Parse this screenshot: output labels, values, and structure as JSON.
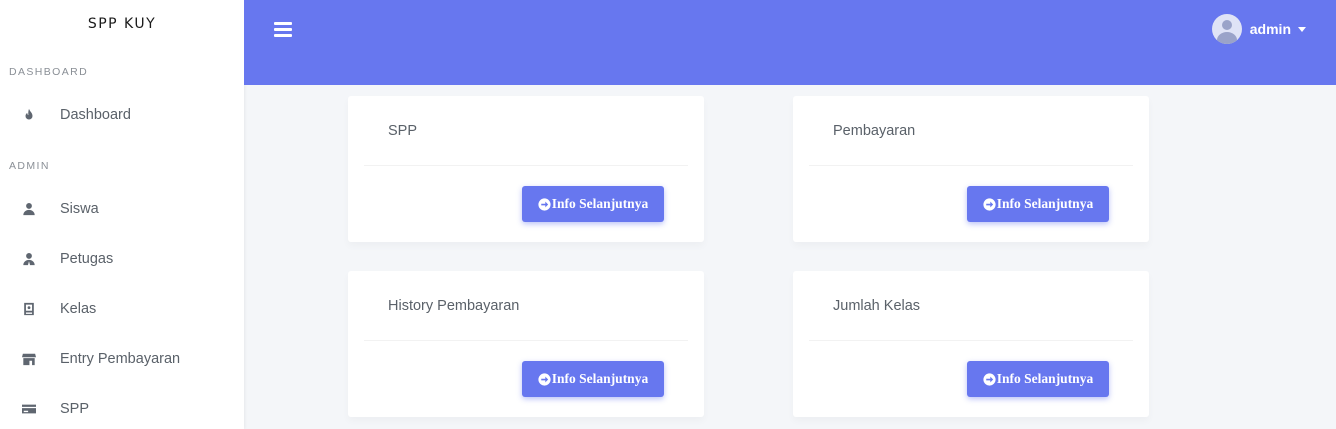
{
  "sidebar": {
    "brand": "SPP KUY",
    "sections": [
      {
        "title": "DASHBOARD"
      },
      {
        "title": "ADMIN"
      }
    ],
    "items": [
      {
        "label": "Dashboard",
        "icon": "fire-icon"
      },
      {
        "label": "Siswa",
        "icon": "user-icon"
      },
      {
        "label": "Petugas",
        "icon": "user-tie-icon"
      },
      {
        "label": "Kelas",
        "icon": "book-icon"
      },
      {
        "label": "Entry Pembayaran",
        "icon": "store-icon"
      },
      {
        "label": "SPP",
        "icon": "credit-card-icon"
      }
    ]
  },
  "topbar": {
    "menu_icon": "hamburger-icon",
    "user": {
      "name": "admin",
      "avatar_icon": "avatar-icon"
    }
  },
  "cards": [
    {
      "title": "SPP",
      "button": "Info Selanjutnya",
      "button_icon": "arrow-circle-right-icon"
    },
    {
      "title": "Pembayaran",
      "button": "Info Selanjutnya",
      "button_icon": "arrow-circle-right-icon"
    },
    {
      "title": "History Pembayaran",
      "button": "Info Selanjutnya",
      "button_icon": "arrow-circle-right-icon"
    },
    {
      "title": "Jumlah Kelas",
      "button": "Info Selanjutnya",
      "button_icon": "arrow-circle-right-icon"
    }
  ],
  "colors": {
    "primary": "#6777ef",
    "background": "#f4f6f9",
    "sidebar_bg": "#ffffff",
    "text": "#5a6169"
  }
}
